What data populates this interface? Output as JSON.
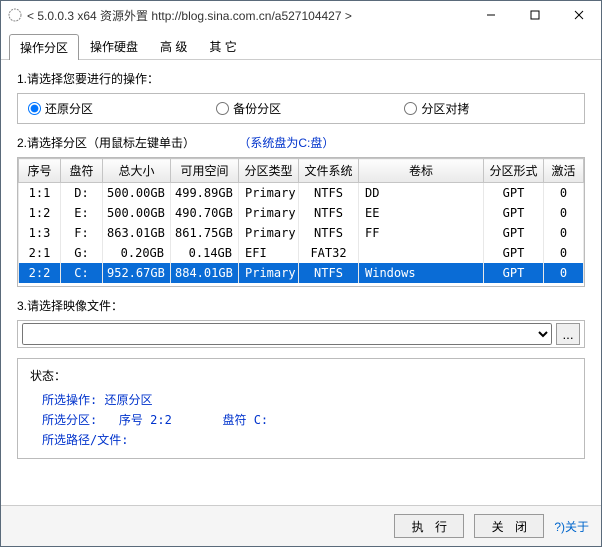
{
  "window": {
    "title": "< 5.0.0.3 x64 资源外置 http://blog.sina.com.cn/a527104427 >"
  },
  "tabs": [
    {
      "label": "操作分区",
      "active": true
    },
    {
      "label": "操作硬盘",
      "active": false
    },
    {
      "label": "高 级",
      "active": false
    },
    {
      "label": "其 它",
      "active": false
    }
  ],
  "section1": {
    "label": "1.请选择您要进行的操作：",
    "options": [
      {
        "label": "还原分区",
        "checked": true
      },
      {
        "label": "备份分区",
        "checked": false
      },
      {
        "label": "分区对拷",
        "checked": false
      }
    ]
  },
  "section2": {
    "label": "2.请选择分区（用鼠标左键单击）",
    "hint": "（系统盘为C:盘）",
    "headers": [
      "序号",
      "盘符",
      "总大小",
      "可用空间",
      "分区类型",
      "文件系统",
      "卷标",
      "分区形式",
      "激活"
    ],
    "rows": [
      {
        "seq": "1:1",
        "drive": "D:",
        "total": "500.00GB",
        "free": "499.89GB",
        "ptype": "Primary",
        "fs": "NTFS",
        "vol": "DD",
        "scheme": "GPT",
        "active": "0",
        "selected": false
      },
      {
        "seq": "1:2",
        "drive": "E:",
        "total": "500.00GB",
        "free": "490.70GB",
        "ptype": "Primary",
        "fs": "NTFS",
        "vol": "EE",
        "scheme": "GPT",
        "active": "0",
        "selected": false
      },
      {
        "seq": "1:3",
        "drive": "F:",
        "total": "863.01GB",
        "free": "861.75GB",
        "ptype": "Primary",
        "fs": "NTFS",
        "vol": "FF",
        "scheme": "GPT",
        "active": "0",
        "selected": false
      },
      {
        "seq": "2:1",
        "drive": "G:",
        "total": "0.20GB",
        "free": "0.14GB",
        "ptype": "EFI",
        "fs": "FAT32",
        "vol": "",
        "scheme": "GPT",
        "active": "0",
        "selected": false
      },
      {
        "seq": "2:2",
        "drive": "C:",
        "total": "952.67GB",
        "free": "884.01GB",
        "ptype": "Primary",
        "fs": "NTFS",
        "vol": "Windows",
        "scheme": "GPT",
        "active": "0",
        "selected": true
      }
    ]
  },
  "section3": {
    "label": "3.请选择映像文件：",
    "value": "",
    "browse": "..."
  },
  "status": {
    "title": "状态：",
    "op_label": "所选操作:",
    "op_value": "还原分区",
    "part_label": "所选分区:",
    "part_seq_label": "序号",
    "part_seq_value": "2:2",
    "part_drive_label": "盘符",
    "part_drive_value": "C:",
    "path_label": "所选路径/文件:",
    "path_value": ""
  },
  "footer": {
    "execute": "执 行",
    "close": "关 闭",
    "about": "?)关于"
  }
}
